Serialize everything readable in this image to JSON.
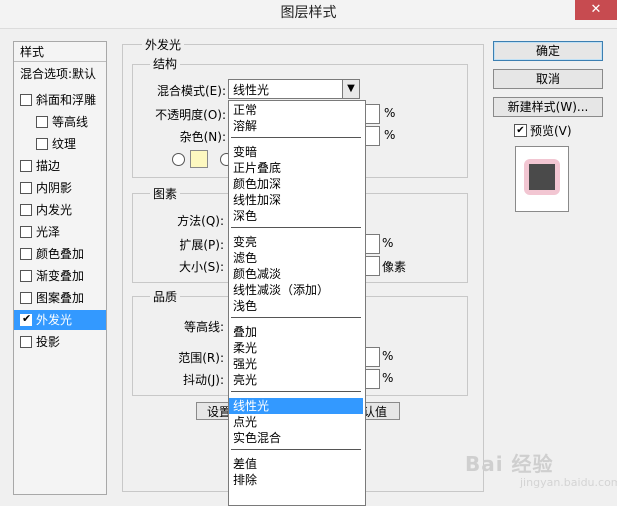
{
  "window": {
    "title": "图层样式",
    "close_label": "✕"
  },
  "left_panel": {
    "header": "样式",
    "blend_options": "混合选项:默认",
    "items": [
      {
        "label": "斜面和浮雕",
        "checked": false,
        "indent": false,
        "selected": false
      },
      {
        "label": "等高线",
        "checked": false,
        "indent": true,
        "selected": false
      },
      {
        "label": "纹理",
        "checked": false,
        "indent": true,
        "selected": false
      },
      {
        "label": "描边",
        "checked": false,
        "indent": false,
        "selected": false
      },
      {
        "label": "内阴影",
        "checked": false,
        "indent": false,
        "selected": false
      },
      {
        "label": "内发光",
        "checked": false,
        "indent": false,
        "selected": false
      },
      {
        "label": "光泽",
        "checked": false,
        "indent": false,
        "selected": false
      },
      {
        "label": "颜色叠加",
        "checked": false,
        "indent": false,
        "selected": false
      },
      {
        "label": "渐变叠加",
        "checked": false,
        "indent": false,
        "selected": false
      },
      {
        "label": "图案叠加",
        "checked": false,
        "indent": false,
        "selected": false
      },
      {
        "label": "外发光",
        "checked": true,
        "indent": false,
        "selected": true
      },
      {
        "label": "投影",
        "checked": false,
        "indent": false,
        "selected": false
      }
    ],
    "check_mark": "✔"
  },
  "outer_glow": {
    "title": "外发光",
    "structure": {
      "title": "结构",
      "blend_mode_label": "混合模式(E):",
      "blend_mode_value": "线性光",
      "opacity_label": "不透明度(O):",
      "opacity_unit": "%",
      "noise_label": "杂色(N):",
      "noise_unit": "%"
    },
    "elements": {
      "title": "图素",
      "technique_label": "方法(Q):",
      "spread_label": "扩展(P):",
      "spread_unit": "%",
      "size_label": "大小(S):",
      "size_unit": "像素"
    },
    "quality": {
      "title": "品质",
      "contour_label": "等高线:",
      "range_label": "范围(R):",
      "range_unit": "%",
      "jitter_label": "抖动(J):",
      "jitter_unit": "%"
    },
    "default_button_partial_left": "设置",
    "default_button_partial_right": "认值"
  },
  "dropdown": {
    "options": [
      "正常",
      "溶解",
      "变暗",
      "正片叠底",
      "颜色加深",
      "线性加深",
      "深色",
      "变亮",
      "滤色",
      "颜色减淡",
      "线性减淡（添加）",
      "浅色",
      "叠加",
      "柔光",
      "强光",
      "亮光",
      "线性光",
      "点光",
      "实色混合",
      "差值",
      "排除"
    ],
    "selected": "线性光"
  },
  "right_panel": {
    "ok": "确定",
    "cancel": "取消",
    "new_style": "新建样式(W)...",
    "preview_label": "预览(V)",
    "preview_checked": true
  },
  "colors": {
    "accent": "#3399ff",
    "glow_swatch": "#fdf8c0",
    "preview_glow": "#f2c6d2"
  },
  "watermark": {
    "brand": "Bai 经验",
    "url": "jingyan.baidu.com"
  }
}
